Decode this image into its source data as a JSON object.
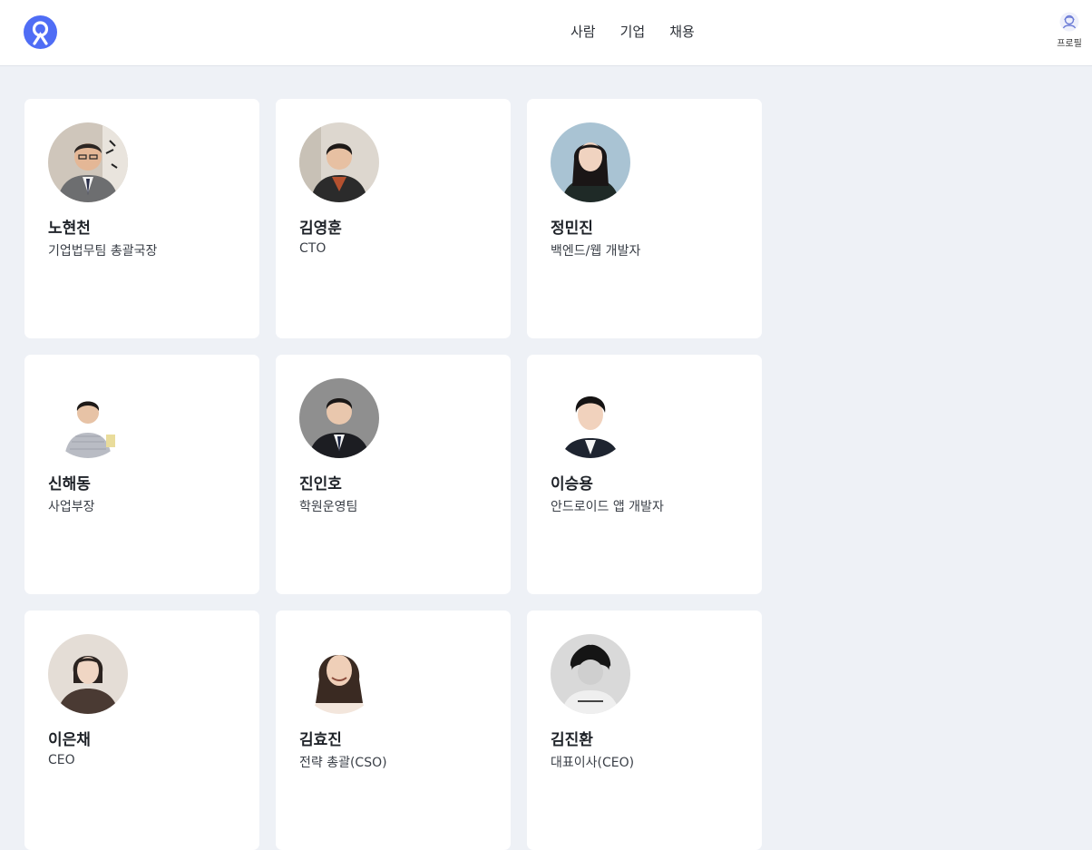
{
  "nav": {
    "items": [
      "사람",
      "기업",
      "채용"
    ]
  },
  "profile": {
    "label": "프로필"
  },
  "colors": {
    "brand": "#4f6df5",
    "page_bg": "#eef1f6",
    "card_bg": "#ffffff"
  },
  "people": [
    {
      "name": "노현천",
      "role": "기업법무팀 총괄국장"
    },
    {
      "name": "김영훈",
      "role": "CTO"
    },
    {
      "name": "정민진",
      "role": "백엔드/웹 개발자"
    },
    {
      "name": "신해동",
      "role": "사업부장"
    },
    {
      "name": "진인호",
      "role": "학원운영팀"
    },
    {
      "name": "이승용",
      "role": "안드로이드 앱 개발자"
    },
    {
      "name": "이은채",
      "role": "CEO"
    },
    {
      "name": "김효진",
      "role": "전략 총괄(CSO)"
    },
    {
      "name": "김진환",
      "role": "대표이사(CEO)"
    }
  ]
}
